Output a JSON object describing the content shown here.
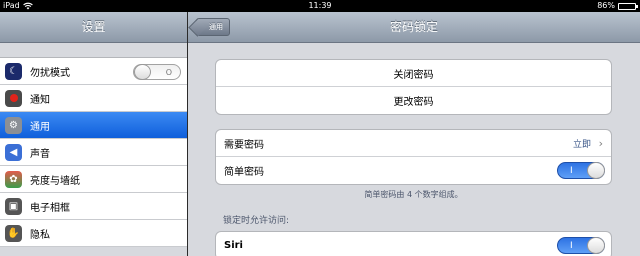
{
  "statusbar": {
    "device": "iPad",
    "time": "11:39",
    "battery_text": "86%",
    "battery_level": 0.86
  },
  "sidebar": {
    "title": "设置",
    "items": [
      {
        "label": "勿扰模式",
        "icon": "moon-icon",
        "toggle": "O"
      },
      {
        "label": "通知",
        "icon": "notifications-icon"
      },
      {
        "label": "通用",
        "icon": "gear-icon",
        "active": true
      },
      {
        "label": "声音",
        "icon": "speaker-icon"
      },
      {
        "label": "亮度与墙纸",
        "icon": "brightness-icon"
      },
      {
        "label": "电子相框",
        "icon": "picture-frame-icon"
      },
      {
        "label": "隐私",
        "icon": "hand-icon"
      }
    ]
  },
  "detail": {
    "back_label": "通用",
    "title": "密码锁定",
    "group1": [
      "关闭密码",
      "更改密码"
    ],
    "require_passcode": {
      "label": "需要密码",
      "value": "立即"
    },
    "simple_passcode": {
      "label": "简单密码",
      "toggle": "I"
    },
    "note": "简单密码由 4 个数字组成。",
    "allow_access_label": "锁定时允许访问:",
    "siri": {
      "label": "Siri",
      "toggle": "I"
    }
  },
  "colors": {
    "accent": "#0f5fdb",
    "toggle_on": "#3b82ee"
  }
}
